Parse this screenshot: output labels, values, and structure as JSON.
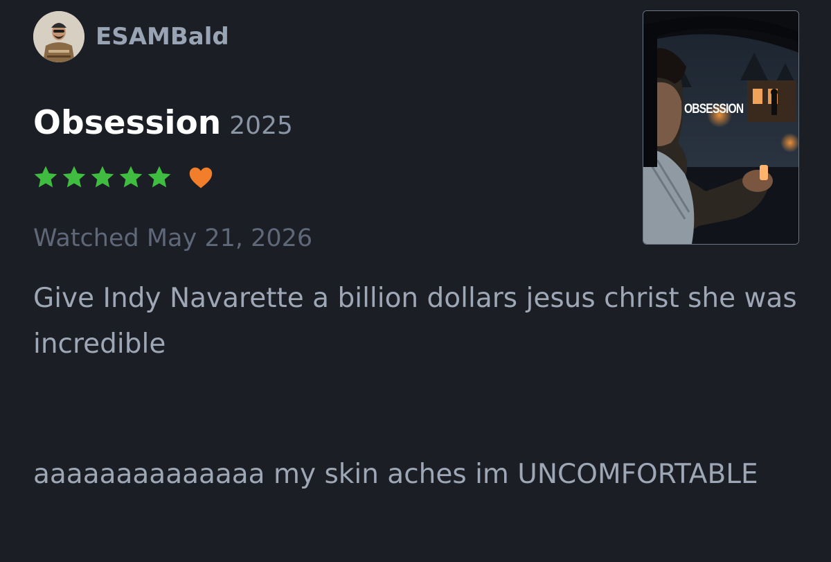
{
  "user": {
    "username": "ESAMBald"
  },
  "film": {
    "title": "Obsession",
    "year": "2025",
    "poster_title": "OBSESSION"
  },
  "rating": {
    "stars": 5,
    "max_stars": 5,
    "liked": true,
    "star_color": "#40bc40",
    "heart_color": "#f27d2b"
  },
  "watched_label": "Watched May 21, 2026",
  "review": {
    "paragraphs": [
      "Give Indy Navarette a billion dollars jesus christ she was incredible",
      "aaaaaaaaaaaaaa my skin aches im UNCOMFORTABLE"
    ]
  },
  "icons": {
    "star": "star-icon",
    "heart": "heart-icon"
  }
}
